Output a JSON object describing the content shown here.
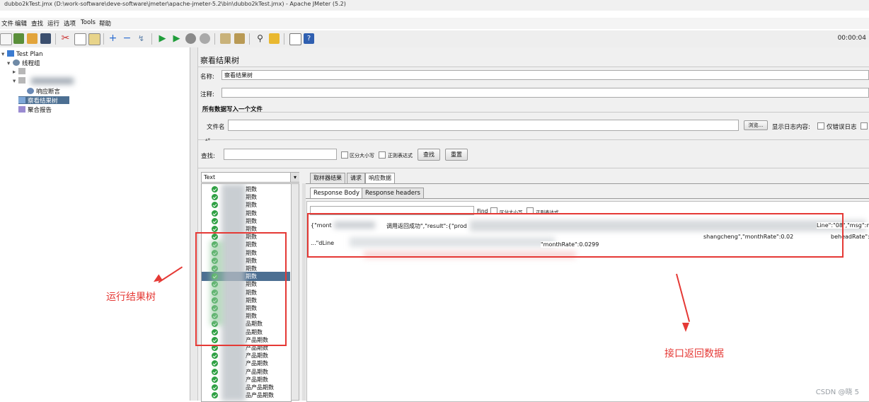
{
  "window": {
    "title": "dubbo2kTest.jmx (D:\\work-software\\deve-software\\jmeter\\apache-jmeter-5.2\\bin\\dubbo2kTest.jmx) - Apache JMeter (5.2)"
  },
  "menu": [
    "文件",
    "编辑",
    "查找",
    "运行",
    "选项",
    "Tools",
    "帮助"
  ],
  "toolbar": {
    "timer": "00:00:04"
  },
  "tree": {
    "test_plan": "Test Plan",
    "thread_group": "线程组",
    "response_assertion": "响应断言",
    "view_results_tree": "察看结果树",
    "aggregate_report": "聚合报告"
  },
  "panel": {
    "title": "察看结果树",
    "name_label": "名称:",
    "name_value": "察看结果树",
    "comment_label": "注释:",
    "write_all_label": "所有数据写入一个文件",
    "filename_label": "文件名",
    "browse_button": "浏览...",
    "log_content_label": "显示日志内容:",
    "errors_only_label": "仅错误日志",
    "search_label": "查找:",
    "case_sensitive_label": "区分大小写",
    "regex_label": "正则表达式",
    "search_button": "查找",
    "reset_button": "重置",
    "renderer_select": "Text"
  },
  "tabs": [
    "取样器结果",
    "请求",
    "响应数据"
  ],
  "subtabs": [
    "Response Body",
    "Response headers"
  ],
  "find_bar": {
    "find_button": "Find",
    "case_label": "区分大小写",
    "regex_label": "正则表达式"
  },
  "response_text": {
    "line1_start": "{\"mont",
    "line1_msg": "调用返回成功\",\"result\":{\"prod",
    "line1_end": "Line\":\"08\",\"msg\":nu",
    "line2_start": "...\"dLine",
    "line2_mid": "\"monthRate\":0.0299",
    "line2_end": "shangcheng\",\"monthRate\":0.02",
    "line2_tail": "beheadRate\":0.0"
  },
  "results": [
    "期数",
    "期数",
    "期数",
    "期数",
    "期数",
    "期数",
    "期数",
    "期数",
    "期数",
    "期数",
    "期数",
    "期数",
    "期数",
    "期数",
    "期数",
    "期数",
    "期数",
    "品期数",
    "品期数",
    "产品期数",
    "产品期数",
    "产品期数",
    "产品期数",
    "产品期数",
    "产品期数",
    "品产品期数",
    "品产品期数"
  ],
  "selected_result_index": 11,
  "annotations": {
    "left": "运行结果树",
    "right": "接口返回数据"
  },
  "watermark": "CSDN @晓 5"
}
